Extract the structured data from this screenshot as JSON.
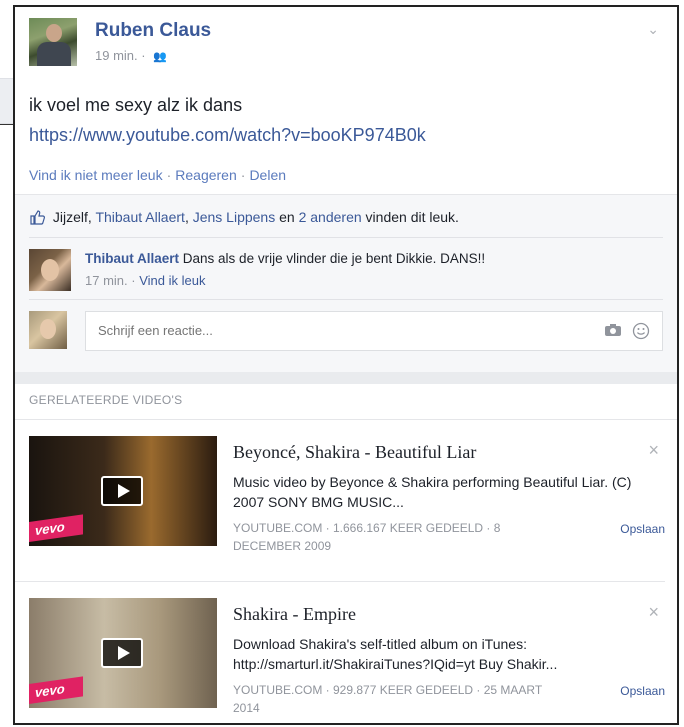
{
  "post": {
    "author": "Ruben Claus",
    "time": "19 min. ·",
    "audience_icon": "friends-icon",
    "text": "ik voel me sexy alz ik dans",
    "link": "https://www.youtube.com/watch?v=booKP974B0k",
    "actions": [
      "Vind ik niet meer leuk",
      "Reageren",
      "Delen"
    ]
  },
  "likes": {
    "prefix": "Jijzelf,",
    "person1": "Thibaut Allaert",
    "sep": ",",
    "person2": "Jens Lippens",
    "and": "en",
    "others": "2 anderen",
    "suffix": "vinden dit leuk."
  },
  "comment": {
    "author": "Thibaut Allaert",
    "text": "Dans als de vrije vlinder die je bent Dikkie. DANS!!",
    "time": "17 min. ·",
    "like_link": "Vind ik leuk"
  },
  "reply": {
    "placeholder": "Schrijf een reactie..."
  },
  "related": {
    "title": "GERELATEERDE VIDEO'S",
    "videos": [
      {
        "title": "Beyoncé, Shakira - Beautiful Liar",
        "desc": "Music video by Beyonce & Shakira performing Beautiful Liar. (C) 2007 SONY BMG MUSIC...",
        "source": "YOUTUBE.COM · 1.666.167 KEER GEDEELD · 8 DECEMBER 2009",
        "save": "Opslaan",
        "badge": "vevo"
      },
      {
        "title": "Shakira - Empire",
        "desc": "Download Shakira's self-titled album on iTunes: http://smarturl.it/ShakiraiTunes?IQid=yt Buy Shakir...",
        "source": "YOUTUBE.COM · 929.877 KEER GEDEELD · 25 MAART 2014",
        "save": "Opslaan",
        "badge": "vevo"
      }
    ]
  },
  "colors": {
    "link": "#3b5998",
    "muted": "#90949c",
    "vevo": "#e02263"
  }
}
